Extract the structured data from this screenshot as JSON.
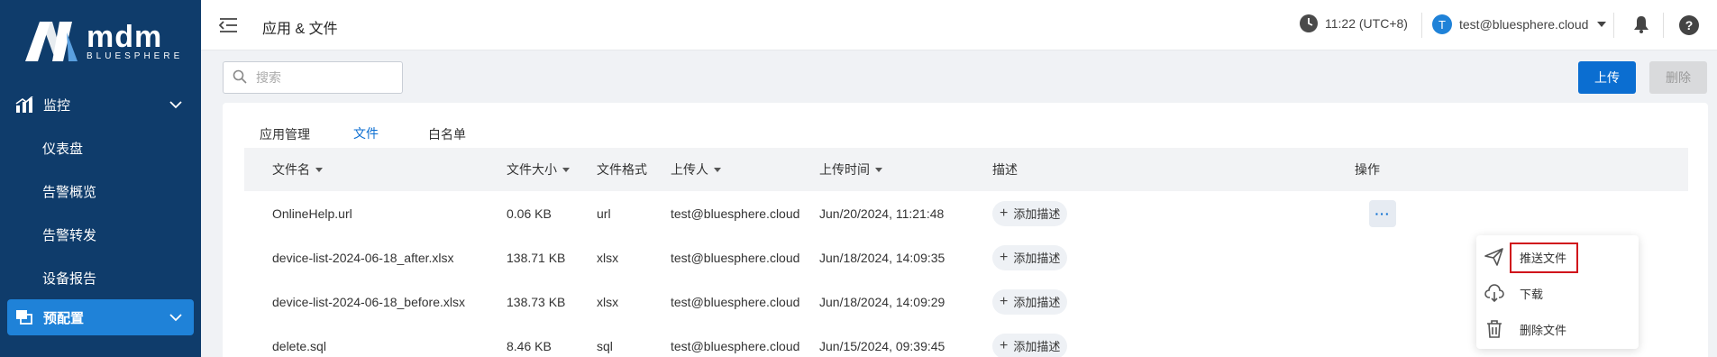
{
  "app": {
    "brand": "mdm",
    "brand_sub": "BLUESPHERE"
  },
  "sidebar": {
    "groups": [
      {
        "label": "监控",
        "icon": "chart-icon"
      },
      {
        "label": "预配置",
        "icon": "layers-icon"
      }
    ],
    "items": [
      "仪表盘",
      "告警概览",
      "告警转发",
      "设备报告"
    ]
  },
  "header": {
    "title": "应用 & 文件",
    "time": "11:22 (UTC+8)",
    "user_initial": "T",
    "user_email": "test@bluesphere.cloud"
  },
  "toolbar": {
    "search_placeholder": "搜索",
    "upload_label": "上传",
    "delete_label": "删除"
  },
  "tabs": [
    "应用管理",
    "文件",
    "白名单"
  ],
  "table": {
    "headers": {
      "name": "文件名",
      "size": "文件大小",
      "format": "文件格式",
      "uploader": "上传人",
      "time": "上传时间",
      "desc": "描述",
      "actions": "操作"
    },
    "add_desc_label": "添加描述",
    "more_label": "···",
    "rows": [
      {
        "name": "OnlineHelp.url",
        "size": "0.06 KB",
        "format": "url",
        "uploader": "test@bluesphere.cloud",
        "time": "Jun/20/2024, 11:21:48"
      },
      {
        "name": "device-list-2024-06-18_after.xlsx",
        "size": "138.71 KB",
        "format": "xlsx",
        "uploader": "test@bluesphere.cloud",
        "time": "Jun/18/2024, 14:09:35"
      },
      {
        "name": "device-list-2024-06-18_before.xlsx",
        "size": "138.73 KB",
        "format": "xlsx",
        "uploader": "test@bluesphere.cloud",
        "time": "Jun/18/2024, 14:09:29"
      },
      {
        "name": "delete.sql",
        "size": "8.46 KB",
        "format": "sql",
        "uploader": "test@bluesphere.cloud",
        "time": "Jun/15/2024, 09:39:45"
      }
    ]
  },
  "menu": {
    "items": [
      {
        "label": "推送文件",
        "icon": "send-icon"
      },
      {
        "label": "下载",
        "icon": "cloud-download-icon"
      },
      {
        "label": "删除文件",
        "icon": "trash-icon"
      }
    ]
  }
}
